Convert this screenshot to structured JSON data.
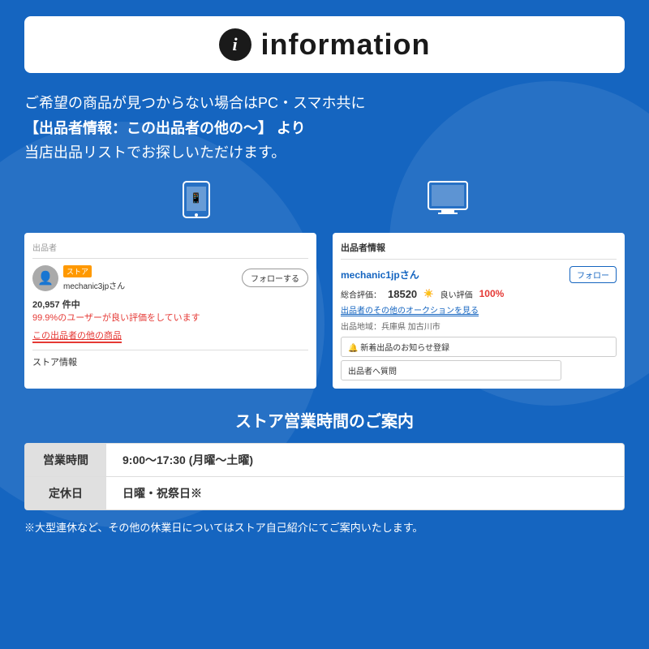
{
  "header": {
    "icon_label": "i",
    "title": "information"
  },
  "description": {
    "line1": "ご希望の商品が見つからない場合はPC・スマホ共に",
    "line2": "【出品者情報：この出品者の他の〜】 より",
    "line3": "当店出品リストでお探しいただけます。"
  },
  "mobile_screenshot": {
    "seller_label": "出品者",
    "store_badge": "ストア",
    "seller_name": "mechanic3jpさん",
    "follow_button": "フォローする",
    "count": "20,957 件中",
    "good_rating": "99.9%のユーザーが良い評価をしています",
    "other_items": "この出品者の他の商品",
    "store_info": "ストア情報"
  },
  "desktop_screenshot": {
    "header": "出品者情報",
    "seller_name": "mechanic1jpさん",
    "follow_button": "フォロー",
    "rating_label": "総合評価：",
    "rating_num": "18520",
    "good_label": "良い評価",
    "good_percent": "100%",
    "auction_link": "出品者のその他のオークションを見る",
    "location_label": "出品地域：兵庫県 加古川市",
    "notify_button": "🔔 新着出品のお知らせ登録",
    "question_button": "出品者へ質問"
  },
  "store_hours": {
    "title": "ストア営業時間のご案内",
    "rows": [
      {
        "label": "営業時間",
        "value": "9:00〜17:30 (月曜〜土曜)"
      },
      {
        "label": "定休日",
        "value": "日曜・祝祭日※"
      }
    ]
  },
  "footnote": "※大型連休など、その他の休業日についてはストア自己紹介にてご案内いたします。"
}
